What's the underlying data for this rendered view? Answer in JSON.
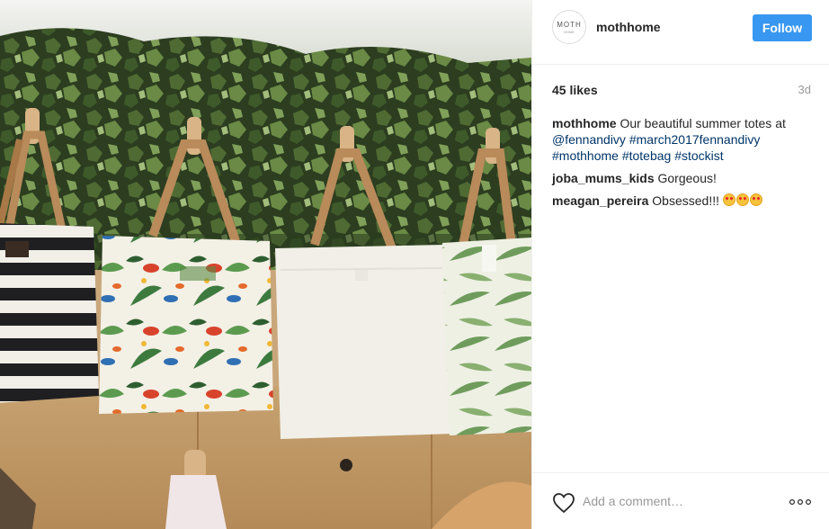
{
  "post": {
    "account": {
      "username": "mothhome",
      "avatar_text": "MOTH",
      "avatar_subtext": "HOME"
    },
    "follow_label": "Follow",
    "likes": "45 likes",
    "time": "3d",
    "caption": {
      "user": "mothhome",
      "text": "Our beautiful summer totes at",
      "tags": [
        "@fennandivy",
        "#march2017fennandivy",
        "#mothhome",
        "#totebag",
        "#stockist"
      ]
    },
    "comments": [
      {
        "user": "joba_mums_kids",
        "text": "Gorgeous!"
      },
      {
        "user": "meagan_pereira",
        "text": "Obsessed!!!",
        "emoji": "heart-eyes-emoji"
      }
    ],
    "add_comment_placeholder": "Add a comment…"
  },
  "icons": {
    "like": "heart-outline-icon",
    "more": "more-options-icon"
  },
  "colors": {
    "accent": "#3897f0",
    "hashtag": "#003569",
    "muted": "#999999",
    "border": "#efefef"
  }
}
